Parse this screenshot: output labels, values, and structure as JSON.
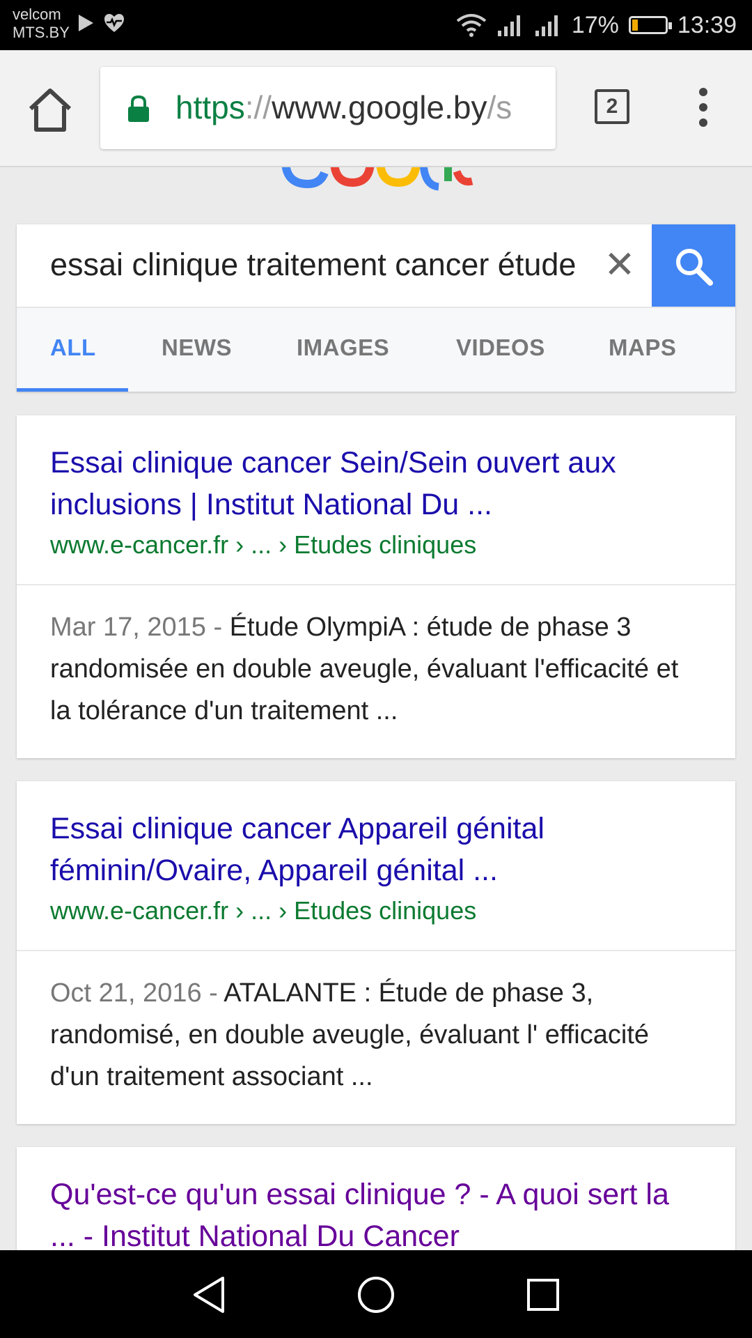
{
  "status_bar": {
    "carrier_line1": "velcom",
    "carrier_line2": "MTS.BY",
    "battery_percent": "17%",
    "battery_level": 0.17,
    "time": "13:39"
  },
  "browser": {
    "url_scheme": "https",
    "url_separator": "://",
    "url_host": "www.google.by",
    "url_rest": "/s",
    "tab_count": "2",
    "icons": [
      "home-icon",
      "lock-icon",
      "tabs-icon",
      "menu-icon"
    ]
  },
  "search": {
    "query": "essai clinique traitement cancer étude",
    "clear_symbol": "✕",
    "tabs": [
      "ALL",
      "NEWS",
      "IMAGES",
      "VIDEOS",
      "MAPS"
    ],
    "active_tab": "ALL"
  },
  "results": [
    {
      "title": "Essai clinique cancer Sein/Sein ouvert aux inclusions | Institut National Du ...",
      "url": "www.e-cancer.fr › ... › Etudes cliniques",
      "date": "Mar 17, 2015 - ",
      "snippet": "Étude OlympiA : étude de phase 3 randomisée en double aveugle, évaluant l'efficacité et la tolérance d'un traitement ..."
    },
    {
      "title": "Essai clinique cancer Appareil génital féminin/Ovaire, Appareil génital ...",
      "url": "www.e-cancer.fr › ... › Etudes cliniques",
      "date": "Oct 21, 2016 - ",
      "snippet": "ATALANTE : Étude de phase 3, randomisé, en double aveugle, évaluant l' efficacité d'un traitement associant ..."
    },
    {
      "title": "Qu'est-ce qu'un essai clinique ? - A quoi sert la ... - Institut National Du Cancer"
    }
  ],
  "colors": {
    "link": "#1a0dab",
    "visited_link": "#660099",
    "url_green": "#0b7a30",
    "accent_blue": "#4285f4"
  }
}
